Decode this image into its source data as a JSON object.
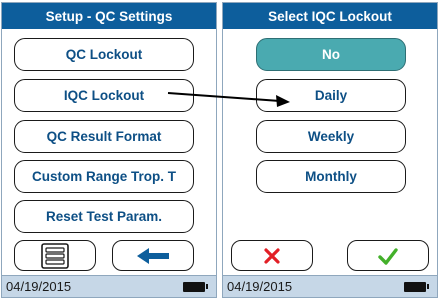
{
  "left_screen": {
    "title": "Setup - QC Settings",
    "menu": [
      {
        "label": "QC Lockout"
      },
      {
        "label": "IQC Lockout"
      },
      {
        "label": "QC Result Format"
      },
      {
        "label": "Custom Range Trop. T"
      },
      {
        "label": "Reset Test Param."
      }
    ],
    "footer": {
      "left_icon": "menu-list-icon",
      "right_icon": "back-arrow-icon"
    },
    "status": {
      "date": "04/19/2015",
      "battery_icon": "battery-icon"
    }
  },
  "right_screen": {
    "title": "Select IQC Lockout",
    "options": [
      {
        "label": "No",
        "selected": true
      },
      {
        "label": "Daily",
        "selected": false
      },
      {
        "label": "Weekly",
        "selected": false
      },
      {
        "label": "Monthly",
        "selected": false
      }
    ],
    "footer": {
      "cancel_icon": "cancel-x-icon",
      "confirm_icon": "confirm-check-icon"
    },
    "status": {
      "date": "04/19/2015",
      "battery_icon": "battery-icon"
    }
  },
  "colors": {
    "title_bar": "#0d5e9c",
    "button_text": "#0d4f85",
    "selected_option": "#4aaab0",
    "status_bar": "#c6d7e7",
    "cancel": "#e21f26",
    "confirm": "#43b02a",
    "back_arrow": "#0d5e9c"
  }
}
